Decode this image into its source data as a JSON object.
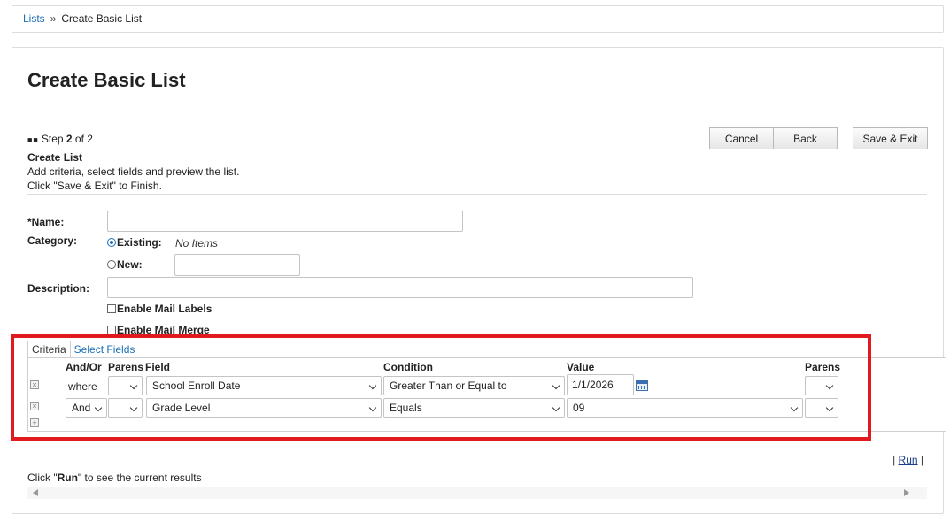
{
  "breadcrumb": {
    "root_link": "Lists",
    "separator": "»",
    "current": "Create Basic List"
  },
  "page": {
    "title": "Create Basic List"
  },
  "step": {
    "squares": "■■",
    "prefix": "Step ",
    "number": "2",
    "suffix": " of 2",
    "heading": "Create List",
    "line1": "Add criteria, select fields and preview the list.",
    "line2": "Click \"Save & Exit\" to Finish."
  },
  "buttons": {
    "cancel": "Cancel",
    "back": "Back",
    "save_exit": "Save & Exit"
  },
  "form": {
    "name_label": "*Name:",
    "name_value": "",
    "category_label": "Category:",
    "existing_label": "Existing:",
    "existing_note": "No Items",
    "new_label": "New:",
    "new_value": "",
    "description_label": "Description:",
    "description_value": "",
    "mail_labels": "Enable Mail Labels",
    "mail_merge": "Enable Mail Merge"
  },
  "tabs": {
    "criteria": "Criteria",
    "select_fields": "Select Fields"
  },
  "criteria": {
    "headers": {
      "and_or": "And/Or",
      "parens_open": "Parens",
      "field": "Field",
      "condition": "Condition",
      "value": "Value",
      "parens_close": "Parens"
    },
    "rows": [
      {
        "and_or": "where",
        "parens_open": "",
        "field": "School Enroll Date",
        "condition": "Greater Than or Equal to",
        "value": "1/1/2026",
        "parens_close": ""
      },
      {
        "and_or": "And",
        "parens_open": "",
        "field": "Grade Level",
        "condition": "Equals",
        "value": "09",
        "parens_close": ""
      }
    ],
    "remove_icon": "remove-row-icon",
    "add_icon": "add-row-icon"
  },
  "results": {
    "run_prefix": "| ",
    "run_link": "Run",
    "run_suffix": " |",
    "hint_before": "Click \"",
    "hint_bold": "Run",
    "hint_after": "\" to see the current results"
  },
  "colors": {
    "link": "#1a6fb5",
    "highlight": "#e11a1f"
  }
}
